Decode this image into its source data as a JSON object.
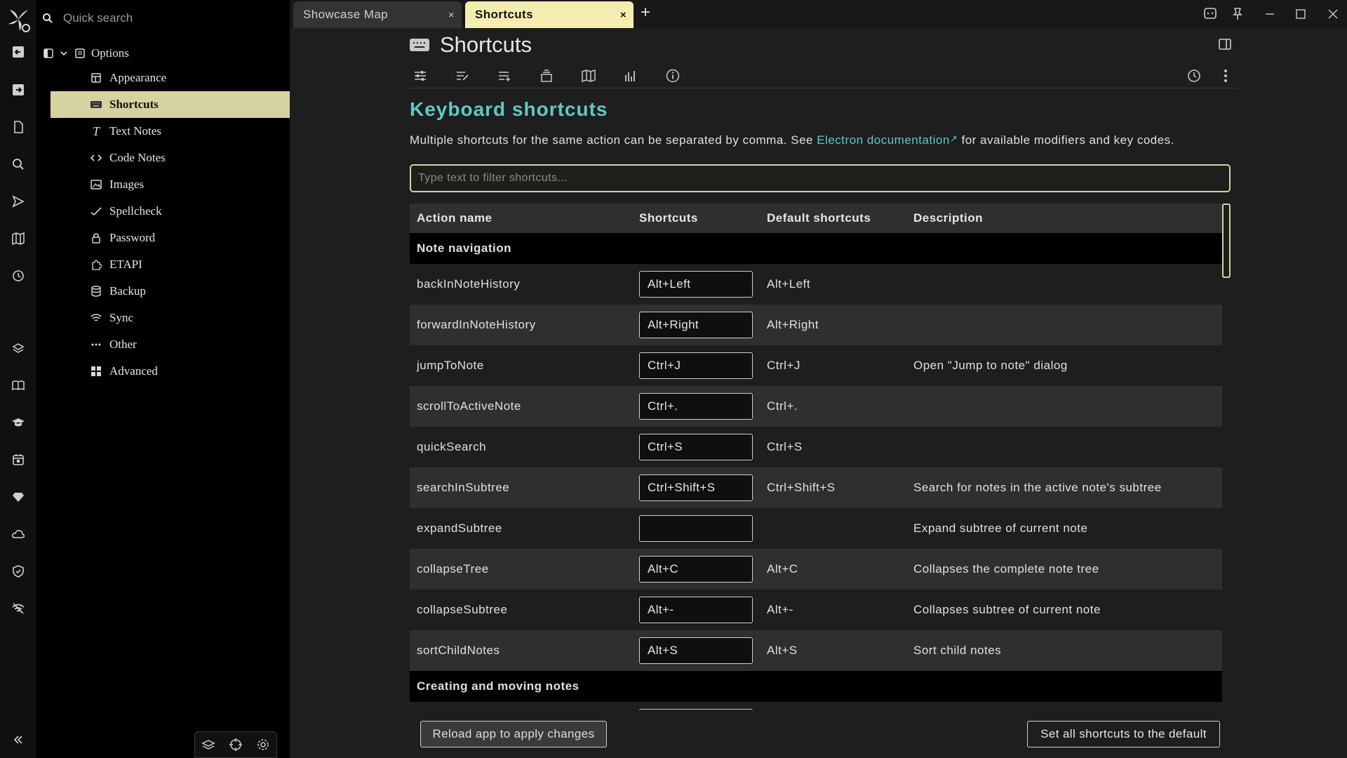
{
  "search": {
    "placeholder": "Quick search"
  },
  "launcher": {
    "items": [
      "logo-icon",
      "back-icon",
      "forward-icon",
      "new-note-icon",
      "search-icon",
      "send-icon",
      "map-icon",
      "history-icon",
      "training-icon",
      "book-icon",
      "graduation-icon",
      "calendar-icon",
      "gem-icon",
      "cloud-icon",
      "shield-icon",
      "wifi-off-icon",
      "collapse-icon"
    ]
  },
  "tree": {
    "root": "Options",
    "items": [
      {
        "label": "Appearance",
        "icon": "layout-icon"
      },
      {
        "label": "Shortcuts",
        "icon": "keyboard-icon",
        "active": true
      },
      {
        "label": "Text Notes",
        "icon": "text-icon"
      },
      {
        "label": "Code Notes",
        "icon": "code-icon"
      },
      {
        "label": "Images",
        "icon": "image-icon"
      },
      {
        "label": "Spellcheck",
        "icon": "spellcheck-icon"
      },
      {
        "label": "Password",
        "icon": "lock-icon"
      },
      {
        "label": "ETAPI",
        "icon": "extension-icon"
      },
      {
        "label": "Backup",
        "icon": "database-icon"
      },
      {
        "label": "Sync",
        "icon": "wifi-icon"
      },
      {
        "label": "Other",
        "icon": "dots-icon"
      },
      {
        "label": "Advanced",
        "icon": "grid-icon"
      }
    ]
  },
  "tabs": [
    {
      "label": "Showcase Map",
      "close": "×"
    },
    {
      "label": "Shortcuts",
      "close": "×"
    }
  ],
  "new_tab": "+",
  "note": {
    "title": "Shortcuts"
  },
  "page": {
    "heading": "Keyboard shortcuts",
    "desc_before": "Multiple shortcuts for the same action can be separated by comma. See ",
    "desc_link": "Electron documentation",
    "desc_link_mark": "↗",
    "desc_after": " for available modifiers and key codes.",
    "filter_placeholder": "Type text to filter shortcuts..."
  },
  "table": {
    "headers": [
      "Action name",
      "Shortcuts",
      "Default shortcuts",
      "Description"
    ],
    "group1": "Note navigation",
    "group2": "Creating and moving notes",
    "rows": [
      {
        "action": "backInNoteHistory",
        "shortcut": "Alt+Left",
        "default": "Alt+Left",
        "description": ""
      },
      {
        "action": "forwardInNoteHistory",
        "shortcut": "Alt+Right",
        "default": "Alt+Right",
        "description": ""
      },
      {
        "action": "jumpToNote",
        "shortcut": "Ctrl+J",
        "default": "Ctrl+J",
        "description": "Open \"Jump to note\" dialog"
      },
      {
        "action": "scrollToActiveNote",
        "shortcut": "Ctrl+.",
        "default": "Ctrl+.",
        "description": ""
      },
      {
        "action": "quickSearch",
        "shortcut": "Ctrl+S",
        "default": "Ctrl+S",
        "description": ""
      },
      {
        "action": "searchInSubtree",
        "shortcut": "Ctrl+Shift+S",
        "default": "Ctrl+Shift+S",
        "description": "Search for notes in the active note's subtree"
      },
      {
        "action": "expandSubtree",
        "shortcut": "",
        "default": "",
        "description": "Expand subtree of current note"
      },
      {
        "action": "collapseTree",
        "shortcut": "Alt+C",
        "default": "Alt+C",
        "description": "Collapses the complete note tree"
      },
      {
        "action": "collapseSubtree",
        "shortcut": "Alt+-",
        "default": "Alt+-",
        "description": "Collapses subtree of current note"
      },
      {
        "action": "sortChildNotes",
        "shortcut": "Alt+S",
        "default": "Alt+S",
        "description": "Sort child notes"
      }
    ]
  },
  "buttons": {
    "reload": "Reload app to apply changes",
    "reset": "Set all shortcuts to the default"
  },
  "colors": {
    "accent": "#5fc9c6",
    "active_bg": "#d7d3a0",
    "active_tab": "#f3eeb0"
  }
}
